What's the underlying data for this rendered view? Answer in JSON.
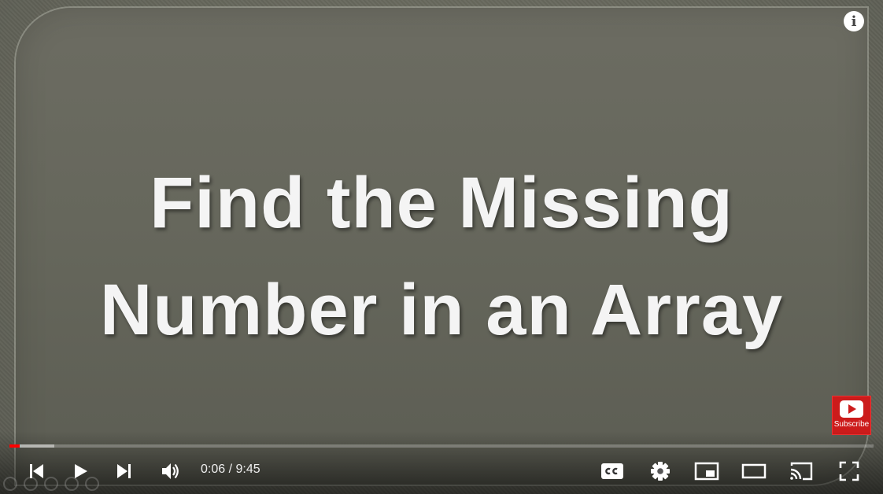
{
  "slide": {
    "title_line1": "Find the Missing",
    "title_line2": "Number in an Array"
  },
  "info": {
    "label": "i"
  },
  "subscribe": {
    "label": "Subscribe",
    "color": "#cc1b1b"
  },
  "player": {
    "current_time": "0:06",
    "separator": " / ",
    "duration": "9:45",
    "played_fraction": 0.012,
    "buffered_fraction": 0.052,
    "progress_color": "#ff0000",
    "icons": {
      "prev": "skip-previous-icon",
      "play": "play-icon",
      "next": "skip-next-icon",
      "volume": "volume-icon",
      "captions": "closed-captions-icon",
      "settings": "gear-icon",
      "miniplayer": "miniplayer-icon",
      "theater": "theater-mode-icon",
      "cast": "cast-icon",
      "fullscreen": "fullscreen-icon"
    }
  }
}
